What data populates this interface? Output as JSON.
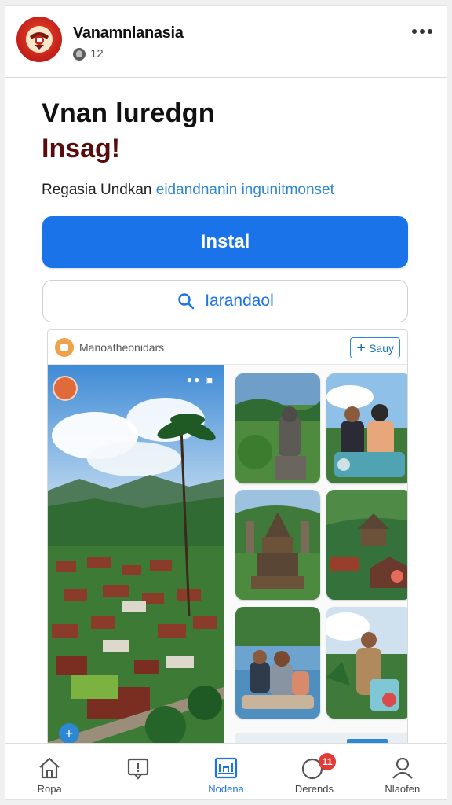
{
  "header": {
    "account_name": "Vanamnlanasia",
    "follower_count": "12"
  },
  "title": {
    "line1": "Vnan luredgn",
    "line2": "Insag!"
  },
  "subtitle": {
    "text": "Regasia Undkan ",
    "link": "eidandnanin ingunitmonset"
  },
  "actions": {
    "install_label": "Instal",
    "search_label": "Iarandaol"
  },
  "preview": {
    "app_title": "Manoatheonidars",
    "save_label": "Sauy",
    "status_icons": "●● ▣"
  },
  "bottom_nav": {
    "items": [
      {
        "label": "Ropa",
        "icon": "home-icon"
      },
      {
        "label": "",
        "icon": "chat-icon"
      },
      {
        "label": "Nodena",
        "icon": "chart-icon"
      },
      {
        "label": "Derends",
        "icon": "notification-icon",
        "badge": "11"
      },
      {
        "label": "Nlaofen",
        "icon": "profile-icon"
      }
    ]
  },
  "colors": {
    "accent": "#1a73e8",
    "title_dark_red": "#5a0c0c",
    "link_blue": "#2d87d3",
    "badge_red": "#e53935"
  }
}
